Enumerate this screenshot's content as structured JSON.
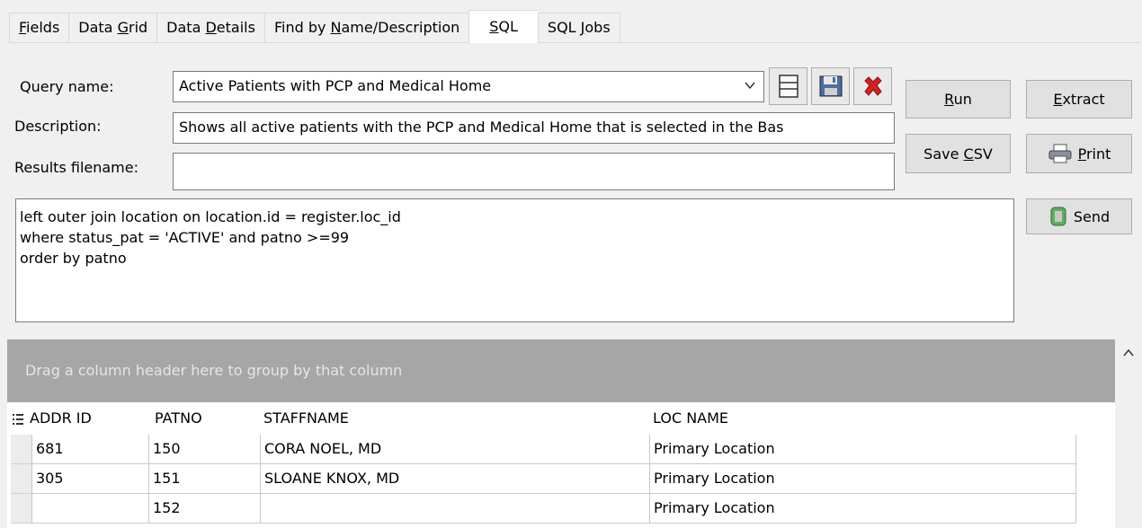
{
  "tabs": [
    {
      "label": "Fields",
      "ul": "F",
      "rest": "ields"
    },
    {
      "label": "Data Grid",
      "pre": "Data ",
      "ul": "G",
      "rest": "rid"
    },
    {
      "label": "Data Details",
      "pre": "Data ",
      "ul": "D",
      "rest": "etails"
    },
    {
      "label": "Find by Name/Description",
      "pre": "Find by ",
      "ul": "N",
      "rest": "ame/Description"
    },
    {
      "label": "SQL",
      "ul": "S",
      "rest": "QL"
    },
    {
      "label": "SQL Jobs",
      "pre": "SQL ",
      "ul": "J",
      "rest": "obs"
    }
  ],
  "active_tab": "SQL",
  "form": {
    "query_name_label": "Query name:",
    "query_name_value": "Active Patients with PCP and Medical Home",
    "description_label": "Description:",
    "description_value": "Shows all active patients with the PCP and Medical Home that is selected in the Bas",
    "results_filename_label": "Results filename:",
    "results_filename_value": ""
  },
  "icons": {
    "new": "document-icon",
    "save": "save-disk-icon",
    "delete": "red-x-icon"
  },
  "buttons": {
    "run": {
      "ul": "R",
      "rest": "un"
    },
    "extract": {
      "ul": "E",
      "rest": "xtract"
    },
    "save_csv": {
      "pre": "Save ",
      "ul": "C",
      "rest": "SV"
    },
    "print": {
      "ul": "P",
      "rest": "rint"
    },
    "send": "Send"
  },
  "sql_text": "left outer join location on location.id = register.loc_id\nwhere status_pat = 'ACTIVE' and patno >=99\norder by patno",
  "grid": {
    "group_hint": "Drag a column header here to group by that column",
    "columns": [
      "ADDR ID",
      "PATNO",
      "STAFFNAME",
      "LOC NAME"
    ],
    "rows": [
      [
        "681",
        "150",
        "CORA NOEL, MD",
        "Primary Location"
      ],
      [
        "305",
        "151",
        "SLOANE KNOX, MD",
        "Primary Location"
      ],
      [
        "",
        "152",
        "",
        "Primary Location"
      ]
    ]
  },
  "colors": {
    "delete_red": "#d42020",
    "group_bar": "#a6a6a6"
  }
}
